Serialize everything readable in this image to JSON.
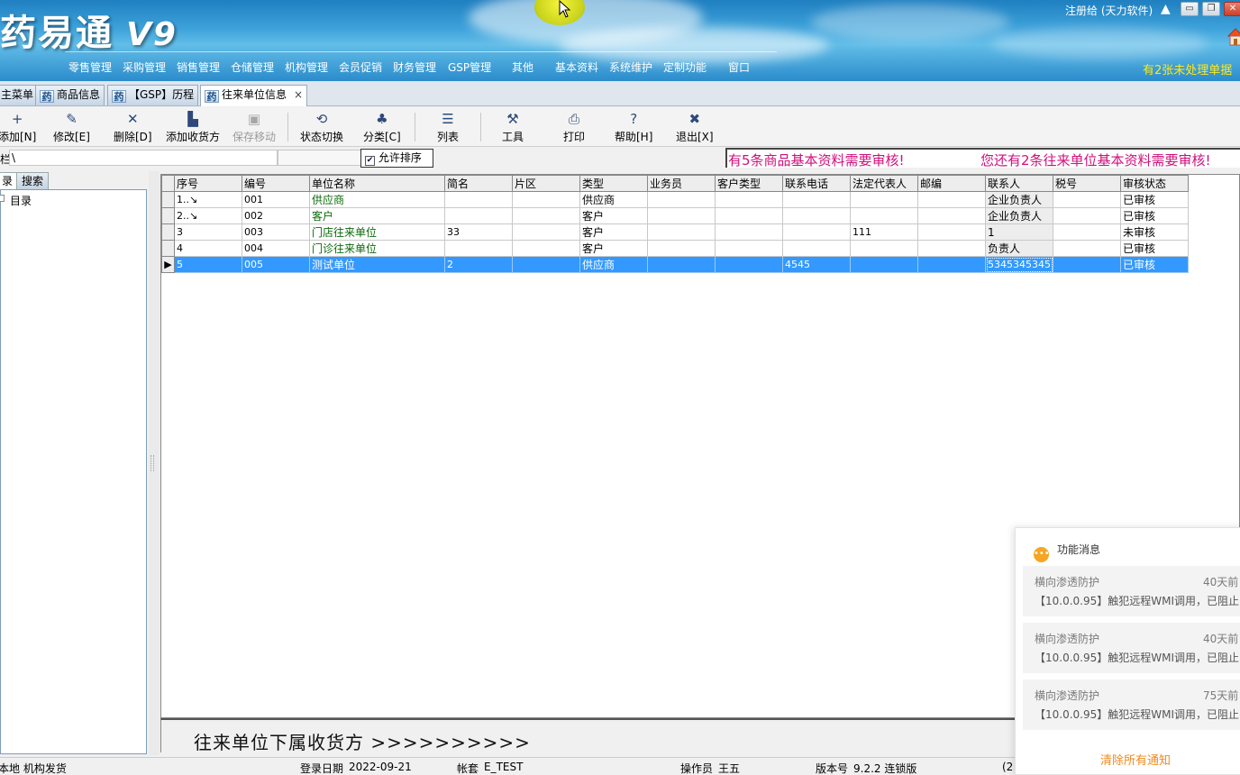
{
  "app": {
    "logo_text": "药易通",
    "logo_version": "V9",
    "registered_to": "注册给 (天力软件)",
    "pending_notice": "有2张未处理单据"
  },
  "window_controls": {
    "minimize": "▭",
    "restore": "❐",
    "close": "✕"
  },
  "menu": {
    "items": [
      "零售管理",
      "采购管理",
      "销售管理",
      "仓储管理",
      "机构管理",
      "会员促销",
      "财务管理",
      "GSP管理",
      "其他",
      "基本资料",
      "系统维护",
      "定制功能",
      "窗口"
    ]
  },
  "tabs": [
    {
      "label": "主菜单",
      "icon": ""
    },
    {
      "label": "商品信息",
      "icon": "药"
    },
    {
      "label": "【GSP】历程",
      "icon": "药"
    },
    {
      "label": "往来单位信息",
      "icon": "药",
      "close": "×"
    }
  ],
  "toolbar": {
    "buttons": [
      {
        "label": "添加[N]",
        "icon": "plus-icon",
        "glyph": "+"
      },
      {
        "label": "修改[E]",
        "icon": "edit-icon",
        "glyph": "✎"
      },
      {
        "label": "删除[D]",
        "icon": "delete-icon",
        "glyph": "✕"
      },
      {
        "label": "添加收货方",
        "icon": "add-receiver-icon",
        "glyph": "▙"
      },
      {
        "label": "保存移动",
        "icon": "save-icon",
        "glyph": "▣"
      },
      {
        "label": "状态切换",
        "icon": "toggle-icon",
        "glyph": "⟲"
      },
      {
        "label": "分类[C]",
        "icon": "category-icon",
        "glyph": "♣"
      },
      {
        "label": "列表",
        "icon": "list-icon",
        "glyph": "☰"
      },
      {
        "label": "工具",
        "icon": "wrench-icon",
        "glyph": "⚒"
      },
      {
        "label": "打印",
        "icon": "printer-icon",
        "glyph": "⎙"
      },
      {
        "label": "帮助[H]",
        "icon": "help-icon",
        "glyph": "?"
      },
      {
        "label": "退出[X]",
        "icon": "exit-icon",
        "glyph": "✖"
      }
    ]
  },
  "filter": {
    "label": "栏",
    "value": "\\",
    "allow_sort_label": "允许排序",
    "allow_sort_checked": "✔"
  },
  "notices": {
    "goods": "有5条商品基本资料需要审核!",
    "units": "您还有2条往来单位基本资料需要审核!"
  },
  "left_panel": {
    "tab_catalog": "录",
    "tab_search": "搜索",
    "tree_root": "目录"
  },
  "grid": {
    "columns": [
      "序号",
      "编号",
      "单位名称",
      "简名",
      "片区",
      "类型",
      "业务员",
      "客户类型",
      "联系电话",
      "法定代表人",
      "邮编",
      "联系人",
      "税号",
      "审核状态"
    ],
    "rows": [
      {
        "seq": "1..↘",
        "code": "001",
        "name": "供应商",
        "short": "",
        "area": "",
        "type": "供应商",
        "salesman": "",
        "ctype": "",
        "phone": "",
        "legal": "",
        "zip": "",
        "contact": "企业负责人",
        "tax": "",
        "status": "已审核"
      },
      {
        "seq": "2..↘",
        "code": "002",
        "name": "客户",
        "short": "",
        "area": "",
        "type": "客户",
        "salesman": "",
        "ctype": "",
        "phone": "",
        "legal": "",
        "zip": "",
        "contact": "企业负责人",
        "tax": "",
        "status": "已审核"
      },
      {
        "seq": "3",
        "code": "003",
        "name": "门店往来单位",
        "short": "33",
        "area": "",
        "type": "客户",
        "salesman": "",
        "ctype": "",
        "phone": "",
        "legal": "111",
        "zip": "",
        "contact": "1",
        "tax": "",
        "status": "未审核"
      },
      {
        "seq": "4",
        "code": "004",
        "name": "门诊往来单位",
        "short": "",
        "area": "",
        "type": "客户",
        "salesman": "",
        "ctype": "",
        "phone": "",
        "legal": "",
        "zip": "",
        "contact": "负责人",
        "tax": "",
        "status": "已审核"
      },
      {
        "seq": "5",
        "code": "005",
        "name": "测试单位",
        "short": "2",
        "area": "",
        "type": "供应商",
        "salesman": "",
        "ctype": "",
        "phone": "4545",
        "legal": "",
        "zip": "",
        "contact": "5345345345",
        "tax": "",
        "status": "已审核"
      }
    ],
    "selected_row": 5
  },
  "sub_panel": {
    "title": "往来单位下属收货方 >>>>>>>>>>"
  },
  "status_bar": {
    "location": "本地 机构发货",
    "login_date_label": "登录日期",
    "login_date": "2022-09-21",
    "account_label": "帐套",
    "account": "E_TEST",
    "operator_label": "操作员",
    "operator": "王五",
    "version_label": "版本号",
    "version": "9.2.2 连锁版",
    "extra": "(2"
  },
  "notification": {
    "title": "功能消息",
    "items": [
      {
        "title": "横向渗透防护",
        "time": "40天前",
        "message": "【10.0.0.95】触犯远程WMI调用，已阻止"
      },
      {
        "title": "横向渗透防护",
        "time": "40天前",
        "message": "【10.0.0.95】触犯远程WMI调用，已阻止"
      },
      {
        "title": "横向渗透防护",
        "time": "75天前",
        "message": "【10.0.0.95】触犯远程WMI调用，已阻止"
      }
    ],
    "clear_label": "清除所有通知"
  }
}
